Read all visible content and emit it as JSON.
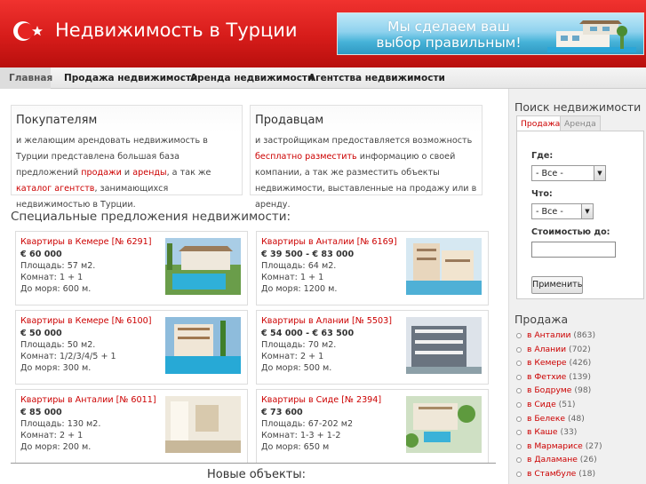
{
  "header": {
    "site_title": "Недвижимость в Турции",
    "banner_text": "Мы сделаем ваш выбор правильным!"
  },
  "nav": {
    "items": [
      "Главная",
      "Продажа недвижимости",
      "Аренда недвижимости",
      "Агентства недвижимости"
    ]
  },
  "buyers": {
    "title": "Покупателям",
    "t1": "и желающим арендовать недвижимость в Турции представлена большая база предложений ",
    "link1": "продажи",
    "t2": " и ",
    "link2": "аренды",
    "t3": ", а так же ",
    "link3": "каталог агентств",
    "t4": ", занимающихся недвижимостью в Турции."
  },
  "sellers": {
    "title": "Продавцам",
    "t1": "и застройщикам предоставляется возможность ",
    "link1": "бесплатно разместить",
    "t2": " информацию о своей компании, а так же разместить объекты недвижимости, выставленные на продажу или в аренду."
  },
  "special": {
    "title": "Специальные предложения недвижимости:",
    "offers": [
      {
        "title": "Квартиры в Кемере [№ 6291]",
        "price": "€ 60 000",
        "area": "Площадь: 57 м2.",
        "rooms": "Комнат: 1 + 1",
        "sea": "До моря: 600 м."
      },
      {
        "title": "Квартиры в Анталии [№ 6169]",
        "price": "€ 39 500 - € 83 000",
        "area": "Площадь: 64 м2.",
        "rooms": "Комнат: 1 + 1",
        "sea": "До моря: 1200 м."
      },
      {
        "title": "Квартиры в Кемере [№ 6100]",
        "price": "€ 50 000",
        "area": "Площадь: 50 м2.",
        "rooms": "Комнат: 1/2/3/4/5 + 1",
        "sea": "До моря: 300 м."
      },
      {
        "title": "Квартиры в Алании [№ 5503]",
        "price": "€ 54 000 - € 63 500",
        "area": "Площадь: 70 м2.",
        "rooms": "Комнат: 2 + 1",
        "sea": "До моря: 500 м."
      },
      {
        "title": "Квартиры в Анталии [№ 6011]",
        "price": "€ 85 000",
        "area": "Площадь: 130 м2.",
        "rooms": "Комнат: 2 + 1",
        "sea": "До моря: 200 м."
      },
      {
        "title": "Квартиры в Сиде [№ 2394]",
        "price": "€ 73 600",
        "area": "Площадь: 67-202 м2",
        "rooms": "Комнат: 1-3 + 1-2",
        "sea": "До моря: 650 м"
      }
    ]
  },
  "new_objects": "Новые объекты:",
  "sidebar": {
    "search_title": "Поиск недвижимости",
    "tab_sale": "Продажа",
    "tab_rent": "Аренда",
    "where_label": "Где:",
    "where_value": "- Все -",
    "what_label": "Что:",
    "what_value": "- Все -",
    "price_label": "Стоимостью до:",
    "price_value": "",
    "apply": "Применить",
    "sale_title": "Продажа",
    "sale_items": [
      {
        "label": "в Анталии",
        "count": "(863)"
      },
      {
        "label": "в Алании",
        "count": "(702)"
      },
      {
        "label": "в Кемере",
        "count": "(426)"
      },
      {
        "label": "в Фетхие",
        "count": "(139)"
      },
      {
        "label": "в Бодруме",
        "count": "(98)"
      },
      {
        "label": "в Сиде",
        "count": "(51)"
      },
      {
        "label": "в Белеке",
        "count": "(48)"
      },
      {
        "label": "в Каше",
        "count": "(33)"
      },
      {
        "label": "в Мармарисе",
        "count": "(27)"
      },
      {
        "label": "в Даламане",
        "count": "(26)"
      },
      {
        "label": "в Стамбуле",
        "count": "(18)"
      }
    ]
  }
}
